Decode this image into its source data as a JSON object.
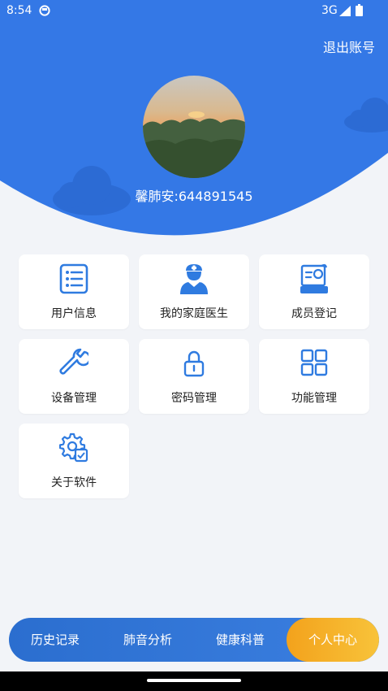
{
  "status_bar": {
    "time": "8:54",
    "network": "3G"
  },
  "header": {
    "logout_label": "退出账号",
    "username": "馨肺安:644891545"
  },
  "colors": {
    "primary": "#3478e6",
    "accent": "#f5b22b",
    "background": "#f2f4f8"
  },
  "menu": [
    {
      "label": "用户信息",
      "icon": "user-info-icon"
    },
    {
      "label": "我的家庭医生",
      "icon": "doctor-icon"
    },
    {
      "label": "成员登记",
      "icon": "member-register-icon"
    },
    {
      "label": "设备管理",
      "icon": "wrench-icon"
    },
    {
      "label": "密码管理",
      "icon": "lock-icon"
    },
    {
      "label": "功能管理",
      "icon": "grid-icon"
    },
    {
      "label": "关于软件",
      "icon": "settings-gear-icon"
    }
  ],
  "tabs": [
    {
      "label": "历史记录",
      "active": false
    },
    {
      "label": "肺音分析",
      "active": false
    },
    {
      "label": "健康科普",
      "active": false
    },
    {
      "label": "个人中心",
      "active": true
    }
  ]
}
